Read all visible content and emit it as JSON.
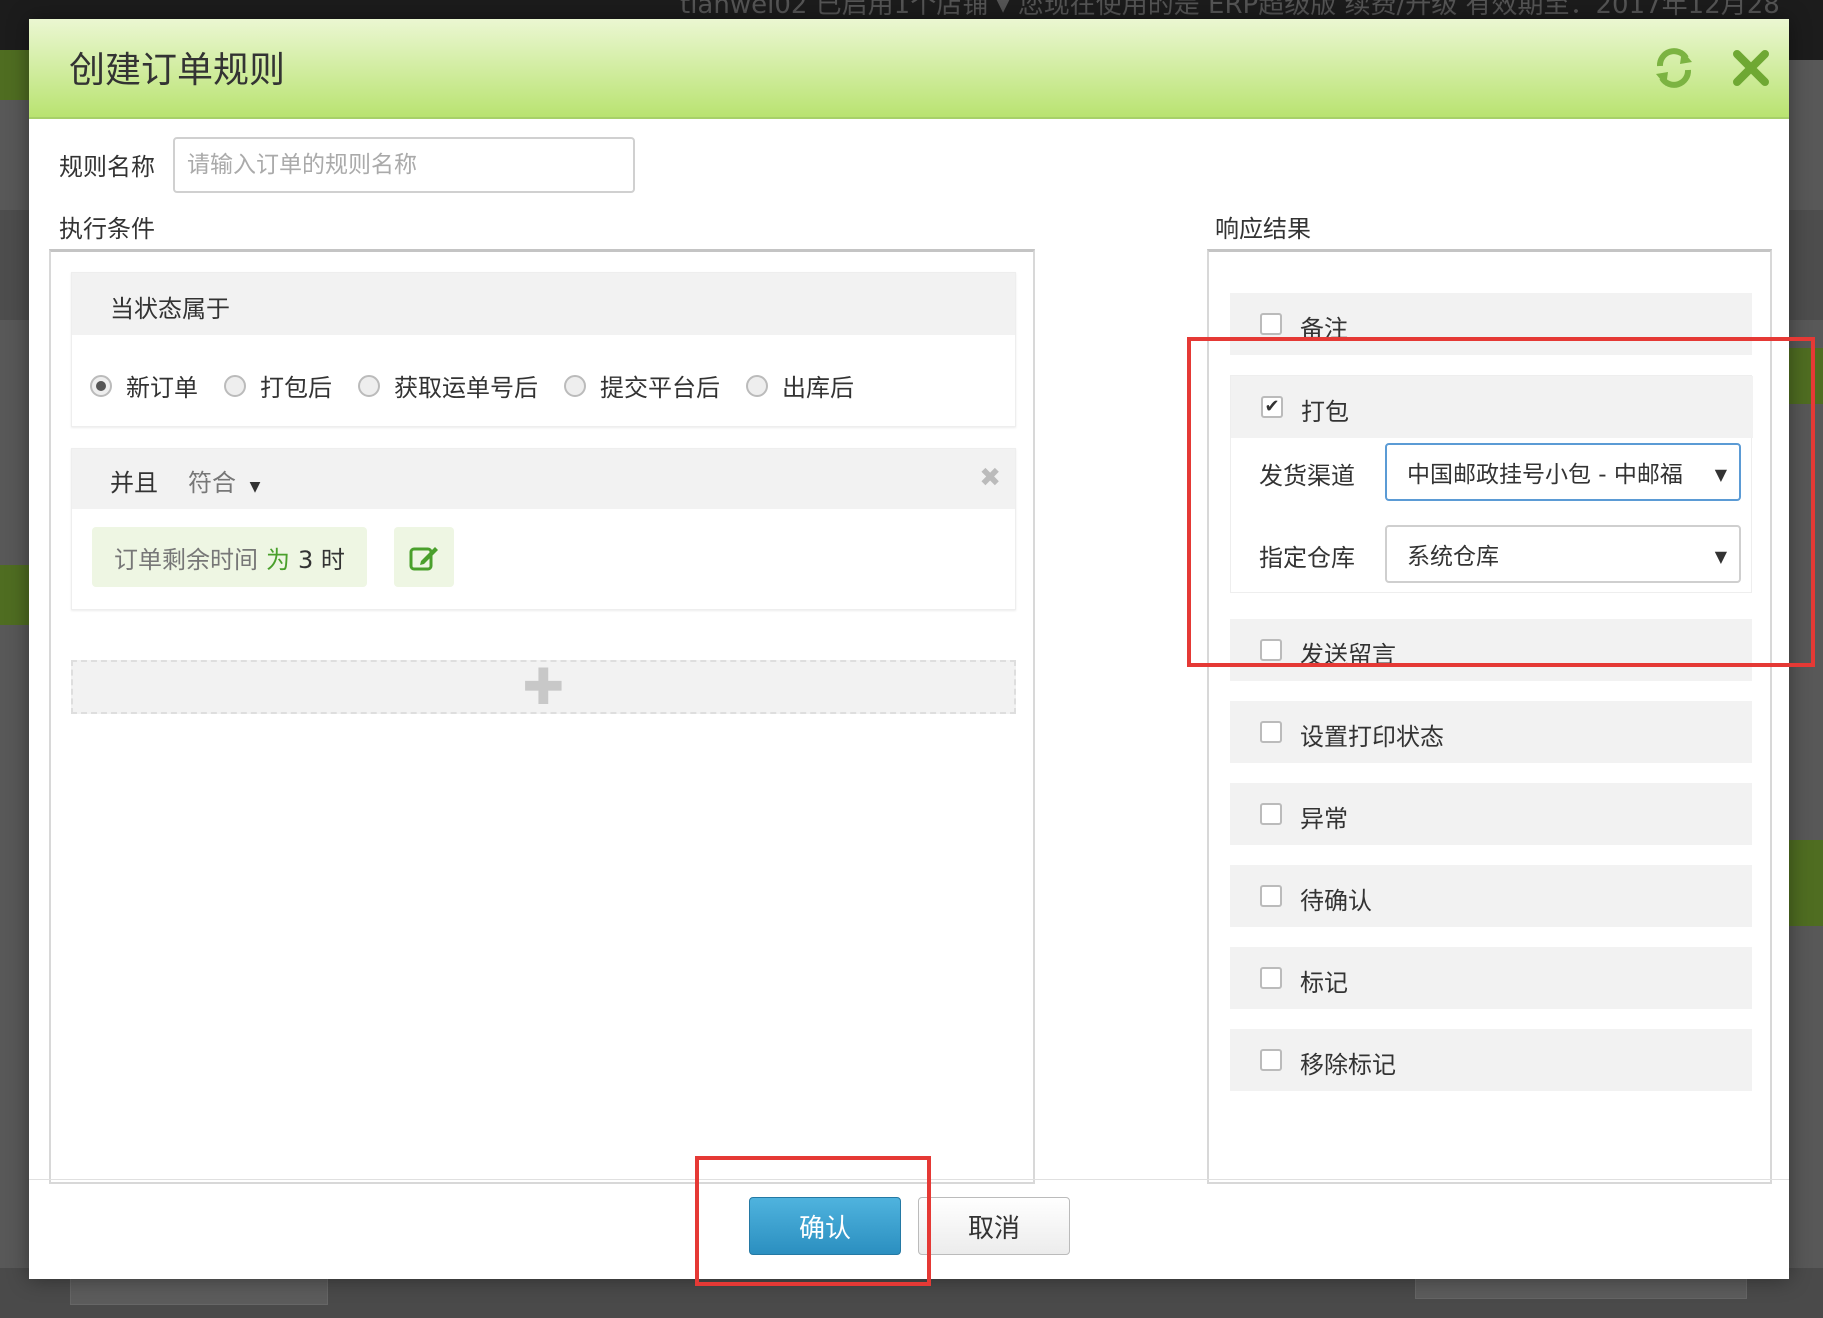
{
  "background": {
    "top_text": "tianwei02   已启用1个店铺 ▾  您现在使用的是 ERP超级版  续费/升级  有效期至：2017年12月28"
  },
  "modal": {
    "title": "创建订单规则",
    "refresh_icon": "refresh-icon",
    "close_icon": "close-icon",
    "rule_name_label": "规则名称",
    "rule_name_placeholder": "请输入订单的规则名称",
    "rule_name_value": "",
    "conditions_title": "执行条件",
    "results_title": "响应结果"
  },
  "conditions": {
    "status_title": "当状态属于",
    "status_options": [
      {
        "label": "新订单",
        "selected": true
      },
      {
        "label": "打包后",
        "selected": false
      },
      {
        "label": "获取运单号后",
        "selected": false
      },
      {
        "label": "提交平台后",
        "selected": false
      },
      {
        "label": "出库后",
        "selected": false
      }
    ],
    "and_label": "并且",
    "match_label": "符合",
    "rule": {
      "field": "订单剩余时间",
      "op": "为",
      "value": "3 时"
    }
  },
  "results": {
    "items": [
      {
        "label": "备注",
        "checked": false
      },
      {
        "label": "打包",
        "checked": true
      },
      {
        "label": "发送留言",
        "checked": false
      },
      {
        "label": "设置打印状态",
        "checked": false
      },
      {
        "label": "异常",
        "checked": false
      },
      {
        "label": "待确认",
        "checked": false
      },
      {
        "label": "标记",
        "checked": false
      },
      {
        "label": "移除标记",
        "checked": false
      }
    ],
    "shipping_channel_label": "发货渠道",
    "shipping_channel_value": "中国邮政挂号小包 - 中邮福",
    "warehouse_label": "指定仓库",
    "warehouse_value": "系统仓库"
  },
  "footer": {
    "confirm_label": "确认",
    "cancel_label": "取消"
  },
  "colors": {
    "header_green": "#b9e371",
    "confirm_blue": "#2b8fc0",
    "highlight_red": "#e53935",
    "tag_green": "#4aa02c"
  }
}
